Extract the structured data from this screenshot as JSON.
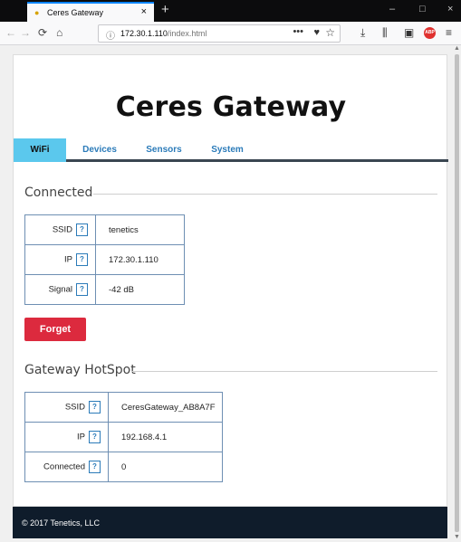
{
  "browser": {
    "tab_title": "Ceres Gateway",
    "tab_close": "×",
    "new_tab": "+",
    "url_host": "172.30.1.110",
    "url_path": "/index.html",
    "url_more": "•••",
    "window_minimize": "–",
    "window_maximize": "□",
    "window_close": "×",
    "abp_label": "ABP"
  },
  "page": {
    "title": "Ceres Gateway",
    "tabs": [
      {
        "label": "WiFi"
      },
      {
        "label": "Devices"
      },
      {
        "label": "Sensors"
      },
      {
        "label": "System"
      }
    ],
    "connected": {
      "heading": "Connected",
      "rows": [
        {
          "key": "SSID",
          "value": "tenetics"
        },
        {
          "key": "IP",
          "value": "172.30.1.110"
        },
        {
          "key": "Signal",
          "value": "-42 dB"
        }
      ]
    },
    "help_label": "?",
    "forget_label": "Forget",
    "hotspot": {
      "heading": "Gateway HotSpot",
      "rows": [
        {
          "key": "SSID",
          "value": "CeresGateway_AB8A7F"
        },
        {
          "key": "IP",
          "value": "192.168.4.1"
        },
        {
          "key": "Connected",
          "value": "0"
        }
      ]
    },
    "footer": "© 2017 Tenetics, LLC"
  },
  "colors": {
    "active_tab": "#5bc8ed",
    "tab_link": "#2b7bb9",
    "forget_button": "#dc2a3e",
    "footer_bg": "#0f1c2b"
  }
}
